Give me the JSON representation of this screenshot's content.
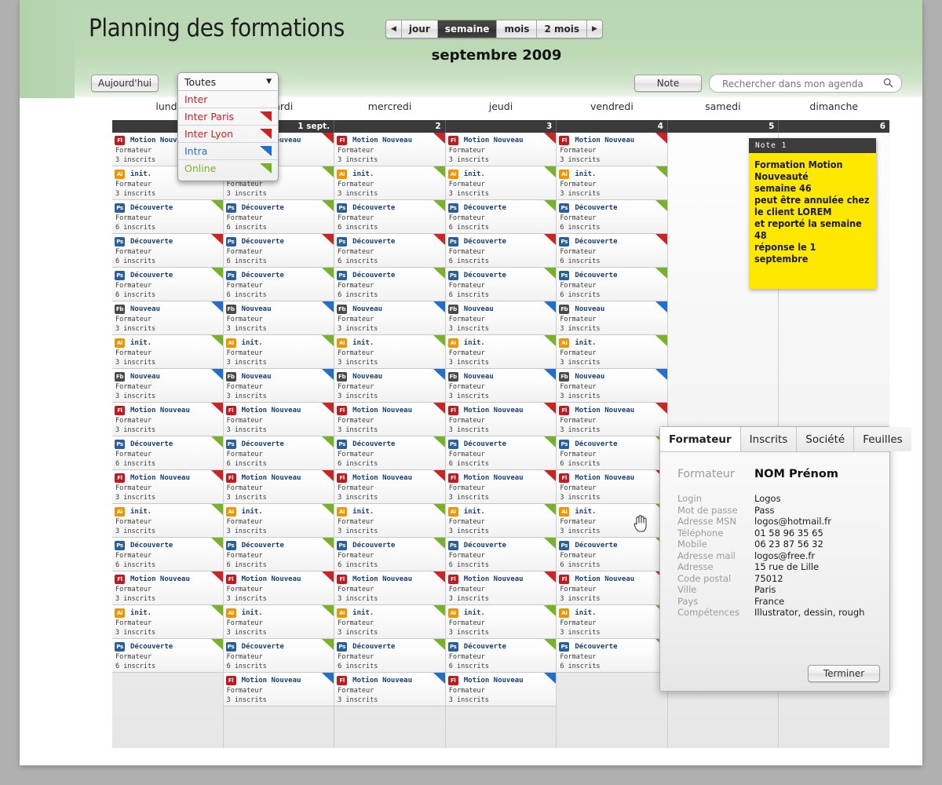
{
  "header": {
    "title": "Planning des formations",
    "month_label": "septembre 2009",
    "view_switcher": {
      "prev_icon": "◀",
      "next_icon": "▶",
      "options": [
        "jour",
        "semaine",
        "mois",
        "2 mois"
      ],
      "selected": "semaine"
    },
    "today_button": "Aujourd'hui",
    "note_button": "Note",
    "search": {
      "placeholder": "Rechercher dans mon agenda",
      "value": "",
      "icon": "search-icon"
    }
  },
  "filter_dropdown": {
    "selected": "Toutes",
    "chevron": "▼",
    "items": [
      {
        "label": "Inter",
        "color_class": "",
        "color": "#c0392b",
        "swatch": false
      },
      {
        "label": "Inter Paris",
        "color_class": "c-red",
        "color": "#cf2222",
        "swatch": true
      },
      {
        "label": "Inter Lyon",
        "color_class": "c-red",
        "color": "#cf2222",
        "swatch": true
      },
      {
        "label": "Intra",
        "color_class": "c-blue",
        "color": "#1f6fd0",
        "swatch": true
      },
      {
        "label": "Online",
        "color_class": "c-green",
        "color": "#77b326",
        "swatch": true
      }
    ]
  },
  "calendar": {
    "day_names": [
      "lundi",
      "mardi",
      "mercredi",
      "jeudi",
      "vendredi",
      "samedi",
      "dimanche"
    ],
    "dates": [
      "",
      "1 sept.",
      "2",
      "3",
      "4",
      "5",
      "6"
    ],
    "event_types": {
      "motion": {
        "badge": "Fl",
        "badge_class": "b-fl",
        "title": "Motion Nouveau",
        "line2": "Formateur",
        "line3": "3 inscrits"
      },
      "init": {
        "badge": "Ai",
        "badge_class": "b-ai",
        "title": "init.",
        "line2": "Formateur",
        "line3": "3 inscrits"
      },
      "decouverte": {
        "badge": "Ps",
        "badge_class": "b-ps",
        "title": "Découverte",
        "line2": "Formateur",
        "line3": "6 inscrits"
      },
      "nouveau": {
        "badge": "Fb",
        "badge_class": "b-fb",
        "title": "Nouveau",
        "line2": "Formateur",
        "line3": "3 inscrits"
      }
    },
    "rows": [
      {
        "type": "motion",
        "flag": "#cf2222"
      },
      {
        "type": "init",
        "flag": "#77b326"
      },
      {
        "type": "decouverte",
        "flag": "#77b326"
      },
      {
        "type": "decouverte",
        "flag": "#cf2222"
      },
      {
        "type": "decouverte",
        "flag": "#77b326"
      },
      {
        "type": "nouveau",
        "flag": "#1f6fd0"
      },
      {
        "type": "init",
        "flag": "#77b326"
      },
      {
        "type": "nouveau",
        "flag": "#1f6fd0"
      },
      {
        "type": "motion",
        "flag": "#cf2222"
      },
      {
        "type": "decouverte",
        "flag": "#77b326"
      },
      {
        "type": "motion",
        "flag": "#cf2222"
      },
      {
        "type": "init",
        "flag": "#77b326"
      },
      {
        "type": "decouverte",
        "flag": "#77b326"
      },
      {
        "type": "motion",
        "flag": "#cf2222"
      },
      {
        "type": "init",
        "flag": "#77b326"
      },
      {
        "type": "decouverte",
        "flag": "#77b326"
      },
      {
        "type": "motion",
        "flag": "#1f6fd0"
      }
    ],
    "column_row_counts": [
      16,
      17,
      17,
      17,
      16,
      0,
      0
    ]
  },
  "note": {
    "header": "Note 1",
    "body": "Formation Motion\nNouveauté\nsemaine 46\npeut être annulée chez\nle client LOREM\net reporté la semaine 48\nréponse le 1 septembre",
    "bg_color": "#ffe800"
  },
  "detail_panel": {
    "tabs": [
      "Formateur",
      "Inscrits",
      "Société",
      "Feuilles"
    ],
    "selected_tab": "Formateur",
    "heading_key": "Formateur",
    "heading_value": "NOM Prénom",
    "fields": [
      {
        "key": "Login",
        "value": "Logos"
      },
      {
        "key": "Mot de passe",
        "value": "Pass"
      },
      {
        "key": "Adresse MSN",
        "value": "logos@hotmail.fr"
      },
      {
        "key": "Téléphone",
        "value": "01 58 96 35 65"
      },
      {
        "key": "Mobile",
        "value": "06 23 87 56 32"
      },
      {
        "key": "Adresse mail",
        "value": "logos@free.fr"
      },
      {
        "key": "Adresse",
        "value": "15 rue de Lille"
      },
      {
        "key": "Code postal",
        "value": "75012"
      },
      {
        "key": "Ville",
        "value": "Paris"
      },
      {
        "key": "Pays",
        "value": "France"
      },
      {
        "key": "Compétences",
        "value": "Illustrator, dessin, rough"
      }
    ],
    "done_button": "Terminer"
  }
}
